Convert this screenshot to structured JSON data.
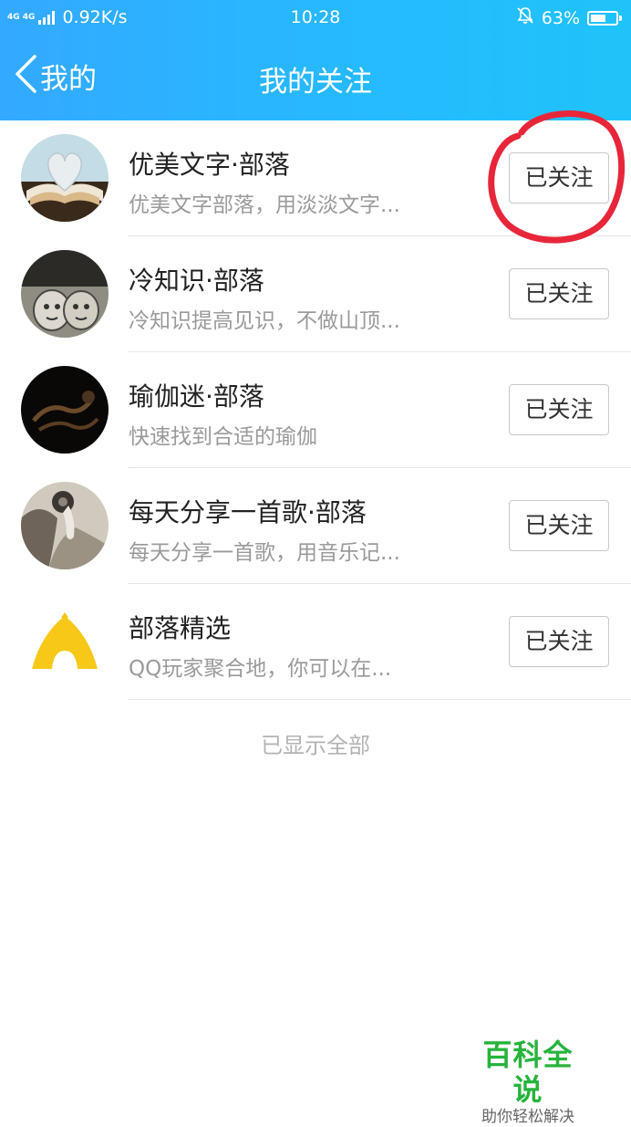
{
  "status_bar": {
    "network_type": "4G 4G",
    "speed": "0.92K/s",
    "time": "10:28",
    "battery_percent": "63%",
    "battery_level": 0.63,
    "icons": [
      "signal-icon",
      "bell-off-icon",
      "battery-icon"
    ]
  },
  "nav": {
    "back_label": "我的",
    "title": "我的关注"
  },
  "list": [
    {
      "title": "优美文字·部落",
      "desc": "优美文字部落，用淡淡文字...",
      "button": "已关注"
    },
    {
      "title": "冷知识·部落",
      "desc": "冷知识提高见识，不做山顶...",
      "button": "已关注"
    },
    {
      "title": "瑜伽迷·部落",
      "desc": "快速找到合适的瑜伽",
      "button": "已关注"
    },
    {
      "title": "每天分享一首歌·部落",
      "desc": "每天分享一首歌，用音乐记...",
      "button": "已关注"
    },
    {
      "title": "部落精选",
      "desc": "QQ玩家聚合地，你可以在...",
      "button": "已关注"
    }
  ],
  "footer_note": "已显示全部",
  "watermark": {
    "title": "百科全说",
    "subtitle": "助你轻松解决"
  },
  "colors": {
    "header_start": "#33a9ff",
    "header_end": "#1fc3fa",
    "annotation_red": "#e8263a",
    "watermark_green": "#27b33c"
  }
}
